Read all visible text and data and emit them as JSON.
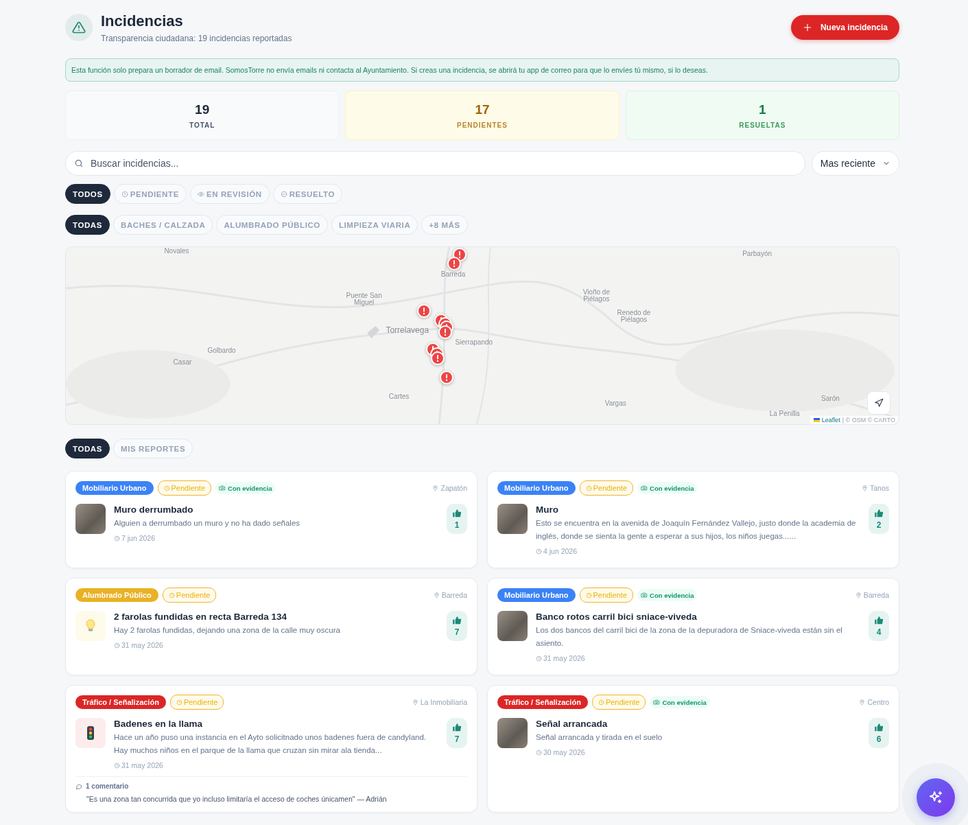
{
  "header": {
    "title": "Incidencias",
    "subtitle": "Transparencia ciudadana: 19 incidencias reportadas",
    "new_button": "Nueva incidencia"
  },
  "notice": "Esta función solo prepara un borrador de email. SomosTorre no envía emails ni contacta al Ayuntamiento. Si creas una incidencia, se abrirá tu app de correo para que lo envíes tú mismo, si lo deseas.",
  "stats": [
    {
      "kind": "total",
      "value": "19",
      "label": "TOTAL"
    },
    {
      "kind": "pending",
      "value": "17",
      "label": "PENDIENTES"
    },
    {
      "kind": "resolved",
      "value": "1",
      "label": "RESUELTAS"
    }
  ],
  "search": {
    "placeholder": "Buscar incidencias..."
  },
  "sort": {
    "value": "Mas reciente"
  },
  "status_filters": [
    {
      "kind": "all",
      "label": "TODOS",
      "selected": true
    },
    {
      "kind": "pending",
      "label": "PENDIENTE",
      "selected": false
    },
    {
      "kind": "review",
      "label": "EN REVISIÓN",
      "selected": false
    },
    {
      "kind": "resolved",
      "label": "RESUELTO",
      "selected": false
    }
  ],
  "category_filters": [
    {
      "label": "TODAS",
      "selected": true
    },
    {
      "label": "BACHES / CALZADA",
      "selected": false
    },
    {
      "label": "ALUMBRADO PÚBLICO",
      "selected": false
    },
    {
      "label": "LIMPIEZA VIARIA",
      "selected": false
    },
    {
      "label": "+8 MÁS",
      "selected": false
    }
  ],
  "map": {
    "places": [
      "Novales",
      "Barreda",
      "Puente San Miguel",
      "Golbardo",
      "Casar",
      "Torrelavega",
      "Sierrapando",
      "Cartes",
      "Parbayón",
      "Vioño de Piélagos",
      "Renedo de Piélagos",
      "Vargas",
      "Sarón",
      "La Penilla"
    ],
    "attribution_link": "Leaflet",
    "attribution": "| © OSM © CARTO"
  },
  "scope_tabs": [
    {
      "label": "TODAS",
      "selected": true
    },
    {
      "label": "MIS REPORTES",
      "selected": false
    }
  ],
  "incidents": [
    {
      "category": "Mobiliario Urbano",
      "color": "#3b82f6",
      "status": "Pendiente",
      "evidence": "Con evidencia",
      "location": "Zapatón",
      "kind": "photo",
      "title": "Muro derrumbado",
      "description": "Alguien a derrumbado un muro y no ha dado señales",
      "date": "7 jun 2026",
      "votes": "1"
    },
    {
      "category": "Mobiliario Urbano",
      "color": "#3b82f6",
      "status": "Pendiente",
      "evidence": "Con evidencia",
      "location": "Tanos",
      "kind": "photo",
      "title": "Muro",
      "description": "Esto se encuentra en la avenida de Joaquín Fernández Vallejo, justo donde la academia de inglés, donde se sienta la gente a esperar a sus hijos, los niños juegas......",
      "date": "4 jun 2026",
      "votes": "2"
    },
    {
      "category": "Alumbrado Público",
      "color": "#e9b125",
      "status": "Pendiente",
      "location": "Barreda",
      "kind": "bulb",
      "title": "2 farolas fundidas en recta Barreda 134",
      "description": "Hay 2 farolas fundidas, dejando una zona de la calle muy oscura",
      "date": "31 may 2026",
      "votes": "7"
    },
    {
      "category": "Mobiliario Urbano",
      "color": "#3b82f6",
      "status": "Pendiente",
      "evidence": "Con evidencia",
      "location": "Barreda",
      "kind": "photo",
      "title": "Banco rotos carril bici sniace-viveda",
      "description": "Los dos bancos del carril bici de la zona de la depuradora de Sniace-viveda están sin el asiento.",
      "date": "31 may 2026",
      "votes": "4"
    },
    {
      "category": "Tráfico / Señalización",
      "color": "#dc2626",
      "status": "Pendiente",
      "location": "La Inmobiliaria",
      "kind": "traffic",
      "title": "Badenes en la llama",
      "description": "Hace un año puso una instancia en el Ayto solicitnado unos badenes fuera de candyland. Hay muchos niños en el parque de la llama que cruzan sin mirar ala tienda...",
      "date": "31 may 2026",
      "votes": "7",
      "comment": {
        "count": "1 comentario",
        "text": "\"Es una zona tan concurrida que yo incluso limitaría el acceso de coches únicamen\" — Adrián"
      }
    },
    {
      "category": "Tráfico / Señalización",
      "color": "#dc2626",
      "status": "Pendiente",
      "evidence": "Con evidencia",
      "location": "Centro",
      "kind": "photo",
      "title": "Señal arrancada",
      "description": "Señal arrancada y tirada en el suelo",
      "date": "30 may 2026",
      "votes": "6"
    }
  ]
}
